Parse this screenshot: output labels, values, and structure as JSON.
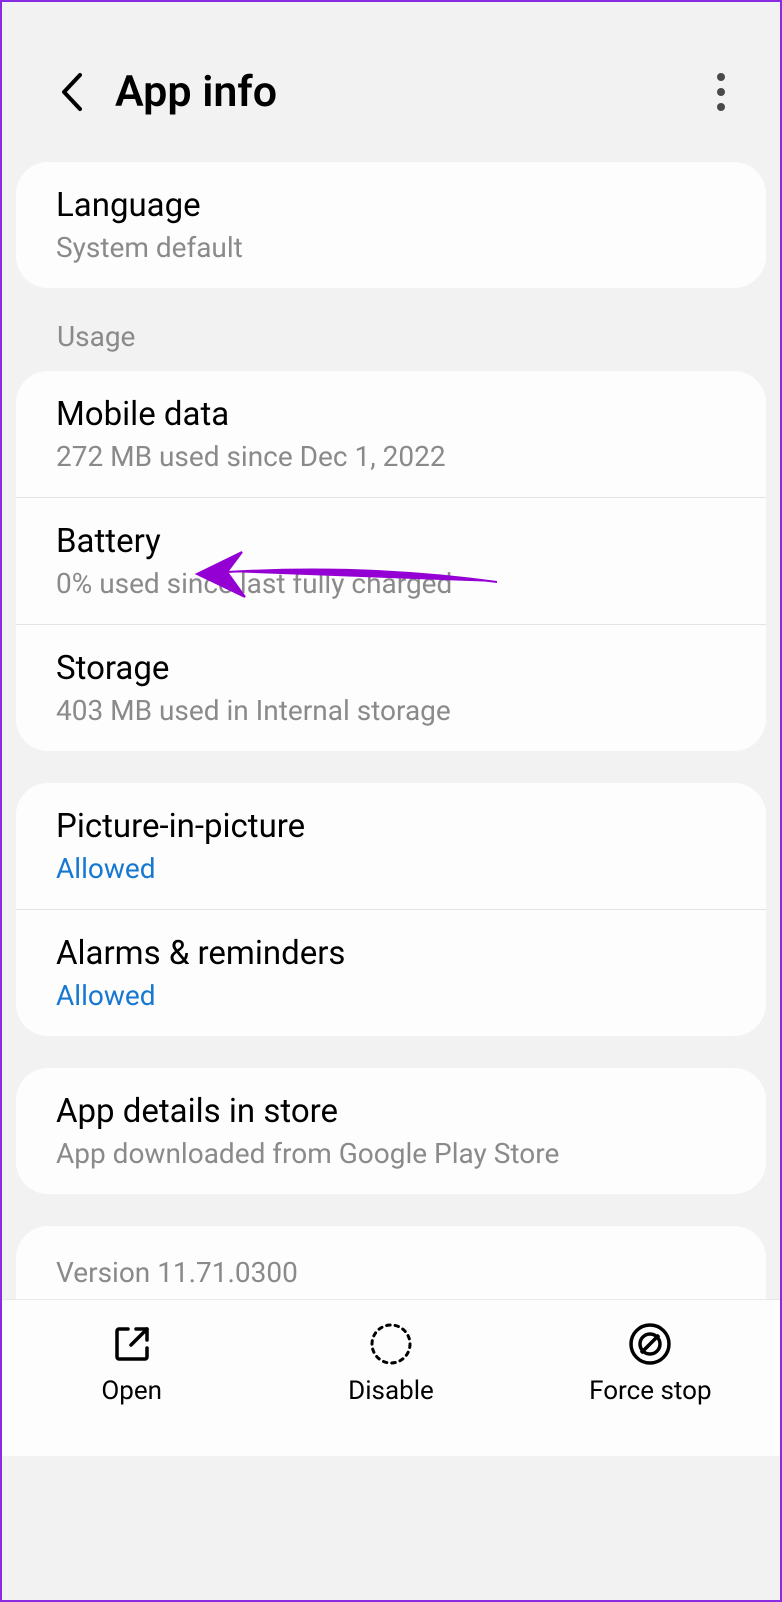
{
  "header": {
    "title": "App info"
  },
  "language": {
    "title": "Language",
    "subtitle": "System default"
  },
  "usage_label": "Usage",
  "mobile_data": {
    "title": "Mobile data",
    "subtitle": "272 MB used since Dec 1, 2022"
  },
  "battery": {
    "title": "Battery",
    "subtitle": "0% used since last fully charged"
  },
  "storage": {
    "title": "Storage",
    "subtitle": "403 MB used in Internal storage"
  },
  "pip": {
    "title": "Picture-in-picture",
    "subtitle": "Allowed"
  },
  "alarms": {
    "title": "Alarms & reminders",
    "subtitle": "Allowed"
  },
  "store": {
    "title": "App details in store",
    "subtitle": "App downloaded from Google Play Store"
  },
  "version": "Version 11.71.0300",
  "bottom": {
    "open": "Open",
    "disable": "Disable",
    "force_stop": "Force stop"
  }
}
